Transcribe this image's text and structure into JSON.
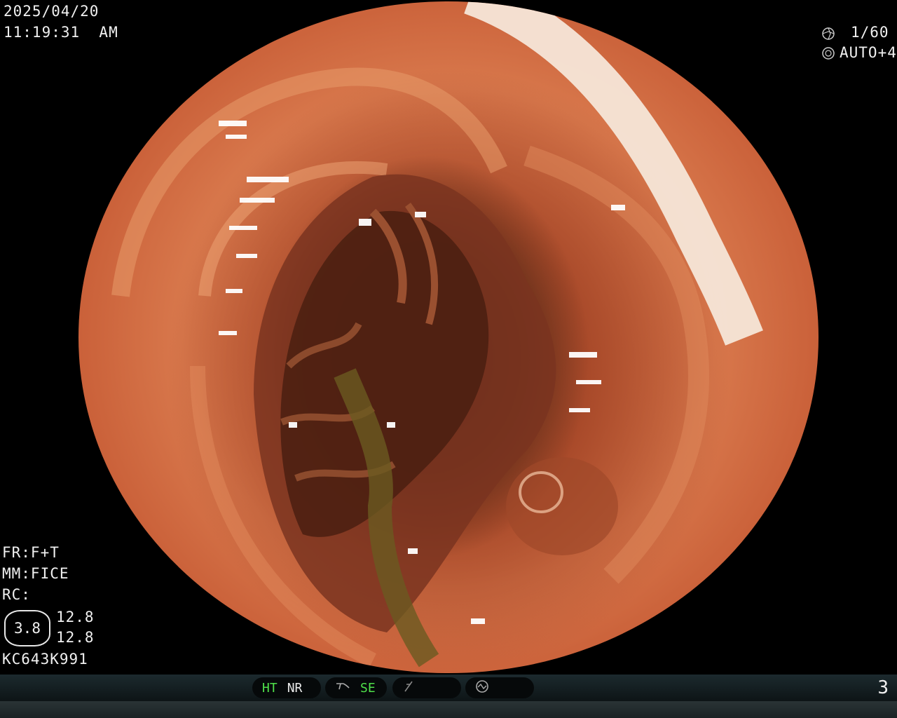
{
  "overlay": {
    "date": "2025/04/20",
    "time": "11:19:31  AM",
    "shutter": "1/60",
    "iris": "AUTO+4",
    "fr": "FR:F+T",
    "mm": "MM:FICE",
    "rc": "RC:",
    "badge_value": "3.8",
    "value_top": "12.8",
    "value_bottom": "12.8",
    "scope_id": "KC643K991"
  },
  "status_bar": {
    "ht": "HT",
    "nr": "NR",
    "se": "SE",
    "page": "3"
  },
  "colors": {
    "indicator_green": "#4fe04a",
    "mucosa": "#d8784c"
  },
  "icons": [
    "shutter-icon",
    "iris-icon",
    "enhance-icon",
    "freeze-icon",
    "release-icon"
  ]
}
